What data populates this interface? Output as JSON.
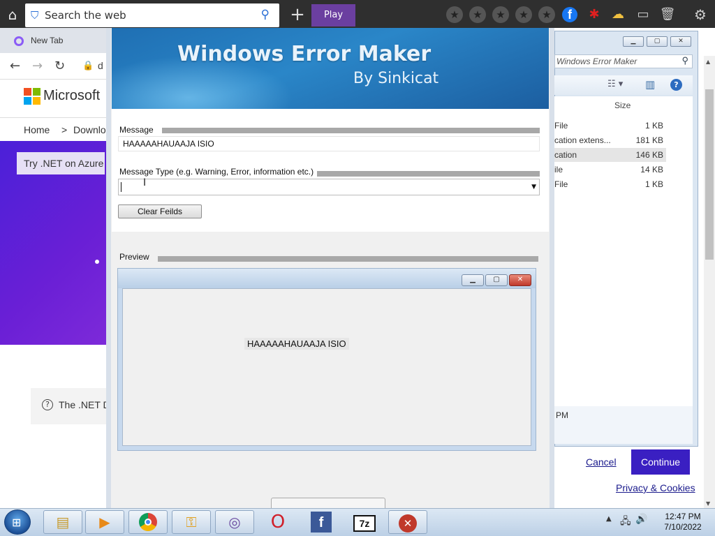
{
  "topbar": {
    "search_placeholder": "Search the web",
    "play_label": "Play"
  },
  "browser": {
    "tab_title": "New Tab",
    "address_partial": "d",
    "brand": "Microsoft",
    "breadcrumb": [
      "Home",
      ">",
      "Downlo"
    ],
    "hero_button": "Try .NET on Azure",
    "card_text": "The .NET D"
  },
  "app": {
    "title": "Windows Error Maker",
    "subtitle": "By Sinkicat",
    "message_label": "Message",
    "message_value": "HAAAAAHAUAAJA ISIO",
    "type_label": "Message Type (e.g. Warning, Error, information etc.)",
    "type_value": "",
    "clear_button": "Clear Feilds",
    "preview_label": "Preview",
    "preview_message": "HAAAAAHAUAAJA ISIO"
  },
  "explorer": {
    "search_text": "Windows Error Maker",
    "size_header": "Size",
    "rows": [
      {
        "name": "File",
        "size": "1 KB",
        "selected": false
      },
      {
        "name": "cation extens...",
        "size": "181 KB",
        "selected": false
      },
      {
        "name": "cation",
        "size": "146 KB",
        "selected": true
      },
      {
        "name": "ile",
        "size": "14 KB",
        "selected": false
      },
      {
        "name": "File",
        "size": "1 KB",
        "selected": false
      }
    ],
    "detail_text": "PM"
  },
  "dialog": {
    "cancel": "Cancel",
    "continue": "Continue",
    "privacy": "Privacy & Cookies"
  },
  "taskbar": {
    "time": "12:47 PM",
    "date": "7/10/2022"
  },
  "colors": {
    "accent_purple": "#3a1fc2",
    "hero_purple": "#5a22d8",
    "play_purple": "#6b3fa0"
  }
}
